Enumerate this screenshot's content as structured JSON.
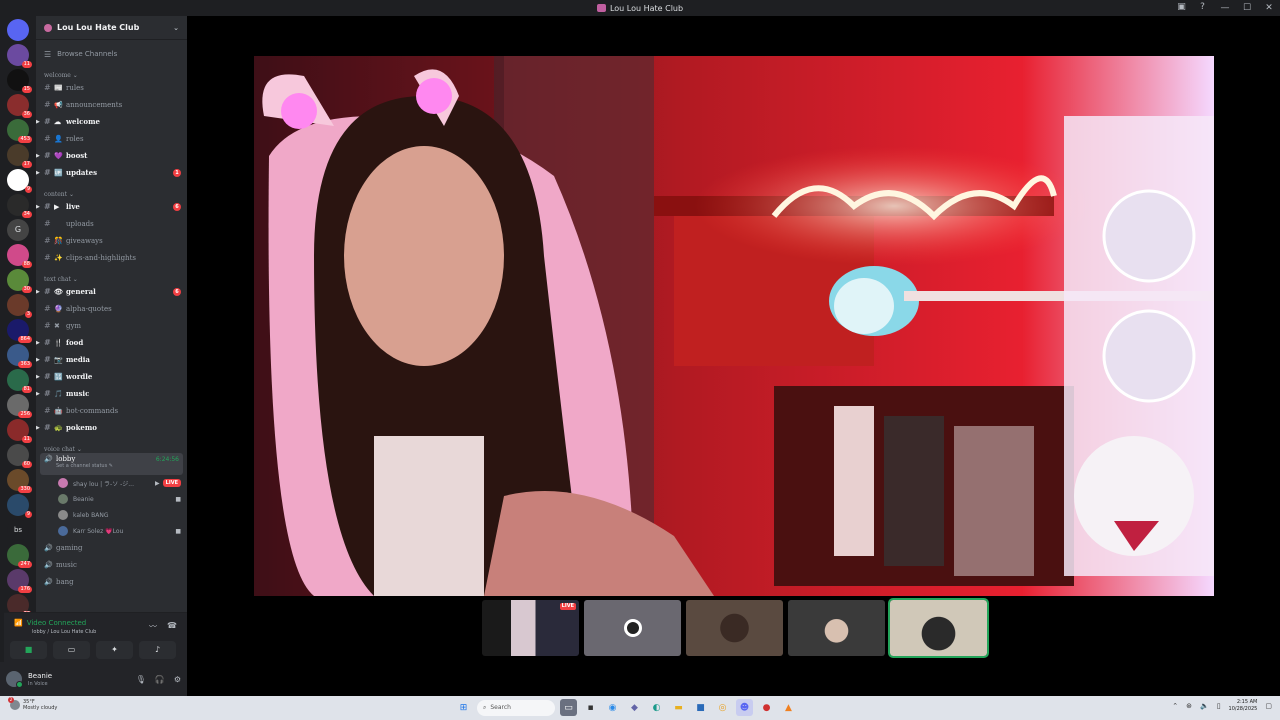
{
  "window": {
    "title": "Lou Lou Hate Club",
    "controls": [
      "—",
      "☐",
      "✕"
    ],
    "icons": [
      "▣",
      "?"
    ]
  },
  "guilds": {
    "items": [
      {
        "color": "#5865f2",
        "badge": ""
      },
      {
        "color": "#6b4aa0",
        "badge": "11"
      },
      {
        "color": "#111111",
        "badge": "15"
      },
      {
        "color": "#8a2d2d",
        "badge": "36"
      },
      {
        "color": "#3a6b3a",
        "badge": "453"
      },
      {
        "color": "#4a3b2a",
        "badge": "17"
      },
      {
        "color": "#ffffff",
        "badge": "9"
      },
      {
        "color": "#2a2a2a",
        "badge": "34"
      },
      {
        "color": "#444444",
        "badge": ""
      },
      {
        "color": "#d04a8a",
        "badge": "88"
      },
      {
        "color": "#5a8a3a",
        "badge": "30"
      },
      {
        "color": "#6a3a2a",
        "badge": "3"
      },
      {
        "color": "#1a1a6a",
        "badge": "864"
      },
      {
        "color": "#3a5a8a",
        "badge": "363"
      },
      {
        "color": "#2a6a4a",
        "badge": "81"
      },
      {
        "color": "#6a6a6a",
        "badge": "256"
      },
      {
        "color": "#8a2a2a",
        "badge": "11"
      },
      {
        "color": "#4a4a4a",
        "badge": "60"
      },
      {
        "color": "#6a4a2a",
        "badge": "330"
      },
      {
        "color": "#2a4a6a",
        "badge": "9"
      },
      {
        "color": "#1e1f22",
        "badge": ""
      },
      {
        "color": "#3a6a3a",
        "badge": "247"
      },
      {
        "color": "#5a3a6a",
        "badge": "176"
      },
      {
        "color": "#4a2a2a",
        "badge": "77"
      }
    ],
    "g_label": "G",
    "bs_label": "bs",
    "new_label": "NEW"
  },
  "sidebar": {
    "server_name": "Lou Lou Hate Club",
    "browse": "Browse Channels",
    "categories": [
      {
        "name": "welcome",
        "channels": [
          {
            "emoji": "📰",
            "name": "rules",
            "bold": false,
            "badge": "",
            "arrow": false
          },
          {
            "emoji": "📢",
            "name": "announcements",
            "bold": false,
            "badge": "",
            "arrow": false
          },
          {
            "emoji": "☁",
            "name": "welcome",
            "bold": true,
            "badge": "",
            "arrow": true
          },
          {
            "emoji": "👤",
            "name": "roles",
            "bold": false,
            "badge": "",
            "arrow": false
          },
          {
            "emoji": "💜",
            "name": "boost",
            "bold": true,
            "badge": "",
            "arrow": true
          },
          {
            "emoji": "🆙",
            "name": "updates",
            "bold": true,
            "badge": "1",
            "arrow": true
          }
        ]
      },
      {
        "name": "content",
        "channels": [
          {
            "emoji": "▶",
            "name": "live",
            "bold": true,
            "badge": "6",
            "arrow": true
          },
          {
            "emoji": "",
            "name": "uploads",
            "bold": false,
            "badge": "",
            "arrow": false
          },
          {
            "emoji": "🎊",
            "name": "giveaways",
            "bold": false,
            "badge": "",
            "arrow": false
          },
          {
            "emoji": "✨",
            "name": "clips-and-highlights",
            "bold": false,
            "badge": "",
            "arrow": false
          }
        ]
      },
      {
        "name": "text chat",
        "channels": [
          {
            "emoji": "👁",
            "name": "general",
            "bold": true,
            "badge": "6",
            "arrow": true
          },
          {
            "emoji": "🔮",
            "name": "alpha-quotes",
            "bold": false,
            "badge": "",
            "arrow": false
          },
          {
            "emoji": "✖",
            "name": "gym",
            "bold": false,
            "badge": "",
            "arrow": false
          },
          {
            "emoji": "🍴",
            "name": "food",
            "bold": true,
            "badge": "",
            "arrow": true
          },
          {
            "emoji": "📷",
            "name": "media",
            "bold": true,
            "badge": "",
            "arrow": true
          },
          {
            "emoji": "🔢",
            "name": "wordle",
            "bold": true,
            "badge": "",
            "arrow": true
          },
          {
            "emoji": "🎵",
            "name": "music",
            "bold": true,
            "badge": "",
            "arrow": true
          },
          {
            "emoji": "🤖",
            "name": "bot-commands",
            "bold": false,
            "badge": "",
            "arrow": false
          },
          {
            "emoji": "🐢",
            "name": "pokemo",
            "bold": true,
            "badge": "",
            "arrow": true
          }
        ]
      }
    ],
    "voice_category": "voice chat",
    "voice_active": {
      "name": "lobby",
      "timer": "6:24:56",
      "status": "Set a channel status ✎"
    },
    "members": [
      {
        "name": "shay lou | ラ-ソ -ジ...",
        "color": "#c87ab0",
        "live": "LIVE",
        "cam": true
      },
      {
        "name": "Beanie",
        "color": "#6a7a6a",
        "live": "",
        "cam": true
      },
      {
        "name": "kaleb BANG",
        "color": "#8a8a8a",
        "live": "",
        "cam": false
      },
      {
        "name": "Karr Solez 💗Lou",
        "color": "#4a6a9a",
        "live": "",
        "cam": true
      }
    ],
    "voice_channels": [
      "gaming",
      "music",
      "bang"
    ]
  },
  "voice_panel": {
    "status": "Video Connected",
    "sub": "lobby / Lou Lou Hate Club"
  },
  "user": {
    "name": "Beanie",
    "status": "In Voice"
  },
  "thumbs": [
    {
      "label": "screen-share-thumb",
      "live": "LIVE"
    },
    {
      "label": "avatar-thumb",
      "live": ""
    },
    {
      "label": "cam-thumb-1",
      "live": ""
    },
    {
      "label": "cam-thumb-2",
      "live": ""
    },
    {
      "label": "cam-thumb-3",
      "live": ""
    }
  ],
  "taskbar": {
    "weather_temp": "35°F",
    "weather_desc": "Mostly cloudy",
    "weather_badge": "2",
    "search": "Search",
    "time": "2:15 AM",
    "date": "10/28/2025"
  }
}
